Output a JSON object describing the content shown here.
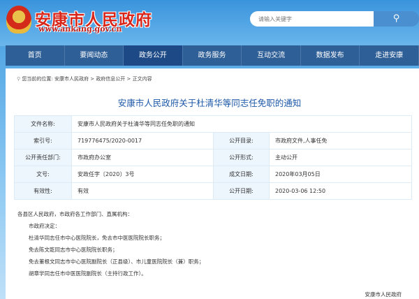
{
  "header": {
    "site_title": "安康市人民政府",
    "site_url": "www.ankang.gov.cn",
    "search_placeholder": "请输入关键字"
  },
  "nav": [
    "首页",
    "要闻动态",
    "政务公开",
    "政务服务",
    "互动交流",
    "数据发布",
    "走进安康"
  ],
  "nav_active": 2,
  "breadcrumb": {
    "prefix": "您当前的位置:",
    "items": [
      "安康市人民政府",
      "政府信息公开",
      "正文内容"
    ],
    "sep": ">"
  },
  "title": "安康市人民政府关于杜清华等同志任免职的通知",
  "meta": {
    "name_label": "文件名称:",
    "name": "安康市人民政府关于杜清华等同志任免职的通知",
    "rows": [
      {
        "l1": "索引号:",
        "v1": "719776475/2020-0017",
        "l2": "公开目录:",
        "v2": "市政府文件,人事任免"
      },
      {
        "l1": "公开责任部门:",
        "v1": "市政府办公室",
        "l2": "公开形式:",
        "v2": "主动公开"
      },
      {
        "l1": "文号:",
        "v1": "安政任字〔2020〕3号",
        "l2": "成文日期:",
        "v2": "2020年03月05日"
      },
      {
        "l1": "有效性:",
        "v1": "有效",
        "l2": "公开日期:",
        "v2": "2020-03-06 12:50"
      }
    ]
  },
  "body": {
    "salutation": "各县区人民政府，市政府各工作部门、直属机构：",
    "lines": [
      "市政府决定：",
      "杜清华同志任市中心医院院长，免去市中医医院院长职务；",
      "免去陈文乾同志市中心医院院长职务；",
      "免去董根文同志市中心医院副院长（正县级）、市儿童医院院长（兼）职务；",
      "胡章学同志任市中医医院副院长（主持行政工作）。"
    ],
    "signature": "安康市人民政府"
  }
}
